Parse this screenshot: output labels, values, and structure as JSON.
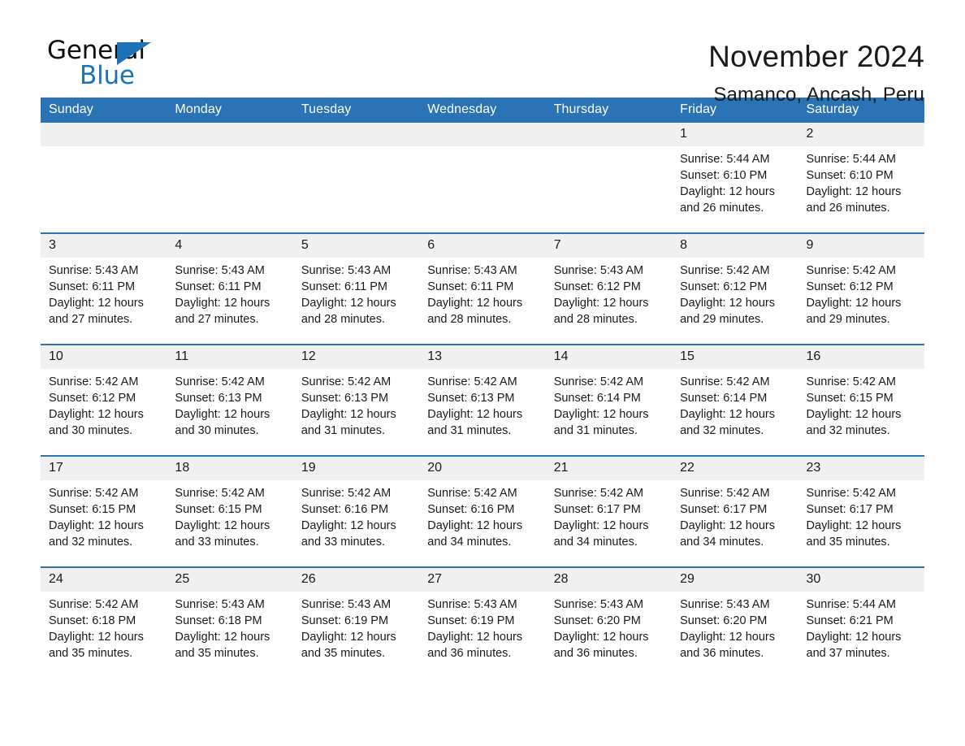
{
  "brand": {
    "name_top": "General",
    "name_bottom": "Blue",
    "mark": "triangle-logo",
    "accent_color": "#1d72b8"
  },
  "header": {
    "title": "November 2024",
    "subtitle": "Samanco, Ancash, Peru"
  },
  "theme": {
    "header_blue": "#2a74b5",
    "daynum_band": "#f0f0f0",
    "text": "#1a1a1a"
  },
  "weekday_headers": [
    "Sunday",
    "Monday",
    "Tuesday",
    "Wednesday",
    "Thursday",
    "Friday",
    "Saturday"
  ],
  "weeks": [
    [
      {
        "day": "",
        "sunrise": "",
        "sunset": "",
        "daylight": ""
      },
      {
        "day": "",
        "sunrise": "",
        "sunset": "",
        "daylight": ""
      },
      {
        "day": "",
        "sunrise": "",
        "sunset": "",
        "daylight": ""
      },
      {
        "day": "",
        "sunrise": "",
        "sunset": "",
        "daylight": ""
      },
      {
        "day": "",
        "sunrise": "",
        "sunset": "",
        "daylight": ""
      },
      {
        "day": "1",
        "sunrise": "Sunrise: 5:44 AM",
        "sunset": "Sunset: 6:10 PM",
        "daylight": "Daylight: 12 hours and 26 minutes."
      },
      {
        "day": "2",
        "sunrise": "Sunrise: 5:44 AM",
        "sunset": "Sunset: 6:10 PM",
        "daylight": "Daylight: 12 hours and 26 minutes."
      }
    ],
    [
      {
        "day": "3",
        "sunrise": "Sunrise: 5:43 AM",
        "sunset": "Sunset: 6:11 PM",
        "daylight": "Daylight: 12 hours and 27 minutes."
      },
      {
        "day": "4",
        "sunrise": "Sunrise: 5:43 AM",
        "sunset": "Sunset: 6:11 PM",
        "daylight": "Daylight: 12 hours and 27 minutes."
      },
      {
        "day": "5",
        "sunrise": "Sunrise: 5:43 AM",
        "sunset": "Sunset: 6:11 PM",
        "daylight": "Daylight: 12 hours and 28 minutes."
      },
      {
        "day": "6",
        "sunrise": "Sunrise: 5:43 AM",
        "sunset": "Sunset: 6:11 PM",
        "daylight": "Daylight: 12 hours and 28 minutes."
      },
      {
        "day": "7",
        "sunrise": "Sunrise: 5:43 AM",
        "sunset": "Sunset: 6:12 PM",
        "daylight": "Daylight: 12 hours and 28 minutes."
      },
      {
        "day": "8",
        "sunrise": "Sunrise: 5:42 AM",
        "sunset": "Sunset: 6:12 PM",
        "daylight": "Daylight: 12 hours and 29 minutes."
      },
      {
        "day": "9",
        "sunrise": "Sunrise: 5:42 AM",
        "sunset": "Sunset: 6:12 PM",
        "daylight": "Daylight: 12 hours and 29 minutes."
      }
    ],
    [
      {
        "day": "10",
        "sunrise": "Sunrise: 5:42 AM",
        "sunset": "Sunset: 6:12 PM",
        "daylight": "Daylight: 12 hours and 30 minutes."
      },
      {
        "day": "11",
        "sunrise": "Sunrise: 5:42 AM",
        "sunset": "Sunset: 6:13 PM",
        "daylight": "Daylight: 12 hours and 30 minutes."
      },
      {
        "day": "12",
        "sunrise": "Sunrise: 5:42 AM",
        "sunset": "Sunset: 6:13 PM",
        "daylight": "Daylight: 12 hours and 31 minutes."
      },
      {
        "day": "13",
        "sunrise": "Sunrise: 5:42 AM",
        "sunset": "Sunset: 6:13 PM",
        "daylight": "Daylight: 12 hours and 31 minutes."
      },
      {
        "day": "14",
        "sunrise": "Sunrise: 5:42 AM",
        "sunset": "Sunset: 6:14 PM",
        "daylight": "Daylight: 12 hours and 31 minutes."
      },
      {
        "day": "15",
        "sunrise": "Sunrise: 5:42 AM",
        "sunset": "Sunset: 6:14 PM",
        "daylight": "Daylight: 12 hours and 32 minutes."
      },
      {
        "day": "16",
        "sunrise": "Sunrise: 5:42 AM",
        "sunset": "Sunset: 6:15 PM",
        "daylight": "Daylight: 12 hours and 32 minutes."
      }
    ],
    [
      {
        "day": "17",
        "sunrise": "Sunrise: 5:42 AM",
        "sunset": "Sunset: 6:15 PM",
        "daylight": "Daylight: 12 hours and 32 minutes."
      },
      {
        "day": "18",
        "sunrise": "Sunrise: 5:42 AM",
        "sunset": "Sunset: 6:15 PM",
        "daylight": "Daylight: 12 hours and 33 minutes."
      },
      {
        "day": "19",
        "sunrise": "Sunrise: 5:42 AM",
        "sunset": "Sunset: 6:16 PM",
        "daylight": "Daylight: 12 hours and 33 minutes."
      },
      {
        "day": "20",
        "sunrise": "Sunrise: 5:42 AM",
        "sunset": "Sunset: 6:16 PM",
        "daylight": "Daylight: 12 hours and 34 minutes."
      },
      {
        "day": "21",
        "sunrise": "Sunrise: 5:42 AM",
        "sunset": "Sunset: 6:17 PM",
        "daylight": "Daylight: 12 hours and 34 minutes."
      },
      {
        "day": "22",
        "sunrise": "Sunrise: 5:42 AM",
        "sunset": "Sunset: 6:17 PM",
        "daylight": "Daylight: 12 hours and 34 minutes."
      },
      {
        "day": "23",
        "sunrise": "Sunrise: 5:42 AM",
        "sunset": "Sunset: 6:17 PM",
        "daylight": "Daylight: 12 hours and 35 minutes."
      }
    ],
    [
      {
        "day": "24",
        "sunrise": "Sunrise: 5:42 AM",
        "sunset": "Sunset: 6:18 PM",
        "daylight": "Daylight: 12 hours and 35 minutes."
      },
      {
        "day": "25",
        "sunrise": "Sunrise: 5:43 AM",
        "sunset": "Sunset: 6:18 PM",
        "daylight": "Daylight: 12 hours and 35 minutes."
      },
      {
        "day": "26",
        "sunrise": "Sunrise: 5:43 AM",
        "sunset": "Sunset: 6:19 PM",
        "daylight": "Daylight: 12 hours and 35 minutes."
      },
      {
        "day": "27",
        "sunrise": "Sunrise: 5:43 AM",
        "sunset": "Sunset: 6:19 PM",
        "daylight": "Daylight: 12 hours and 36 minutes."
      },
      {
        "day": "28",
        "sunrise": "Sunrise: 5:43 AM",
        "sunset": "Sunset: 6:20 PM",
        "daylight": "Daylight: 12 hours and 36 minutes."
      },
      {
        "day": "29",
        "sunrise": "Sunrise: 5:43 AM",
        "sunset": "Sunset: 6:20 PM",
        "daylight": "Daylight: 12 hours and 36 minutes."
      },
      {
        "day": "30",
        "sunrise": "Sunrise: 5:44 AM",
        "sunset": "Sunset: 6:21 PM",
        "daylight": "Daylight: 12 hours and 37 minutes."
      }
    ]
  ]
}
